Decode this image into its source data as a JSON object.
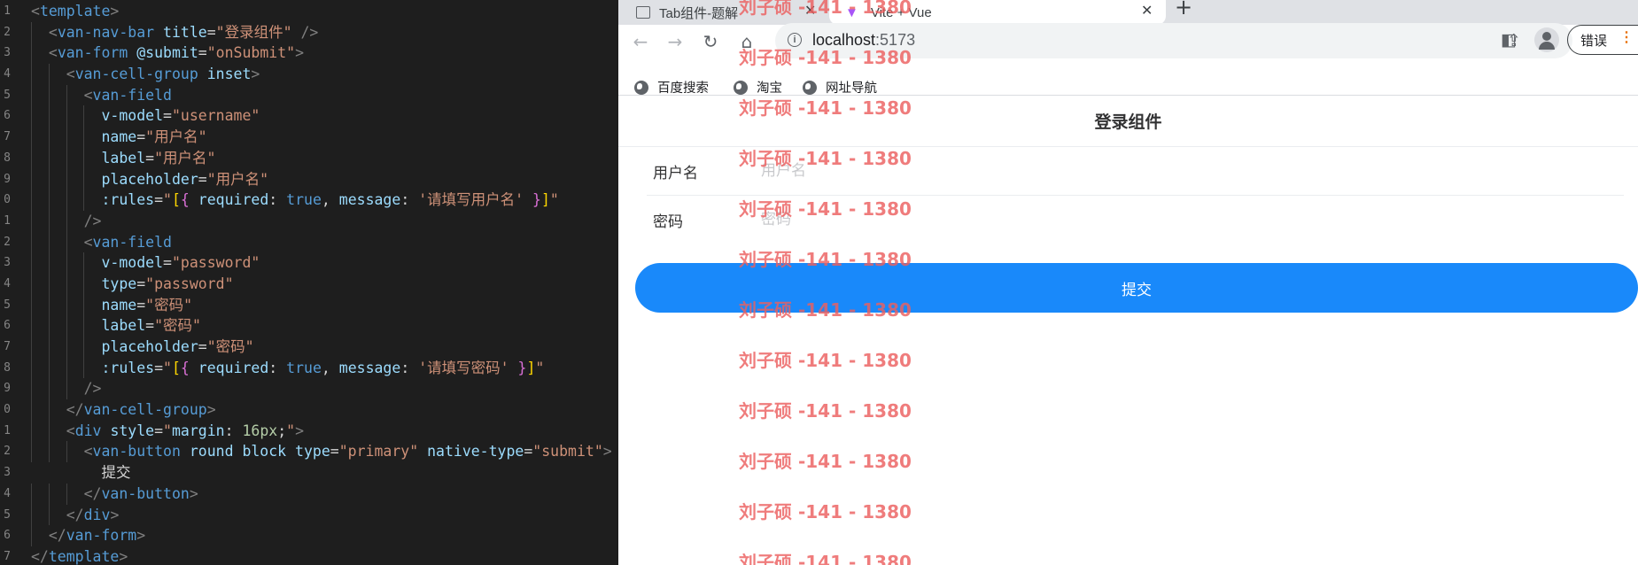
{
  "editor": {
    "lines": [
      [
        {
          "c": "c-br",
          "t": "<"
        },
        {
          "c": "c-tag",
          "t": "template"
        },
        {
          "c": "c-br",
          "t": ">"
        }
      ],
      [
        {
          "c": "",
          "t": "  "
        },
        {
          "c": "c-br",
          "t": "<"
        },
        {
          "c": "c-tag",
          "t": "van-nav-bar"
        },
        {
          "c": "",
          "t": " "
        },
        {
          "c": "c-attr",
          "t": "title"
        },
        {
          "c": "",
          "t": "="
        },
        {
          "c": "c-str",
          "t": "\"登录组件\""
        },
        {
          "c": "",
          "t": " "
        },
        {
          "c": "c-br",
          "t": "/>"
        }
      ],
      [
        {
          "c": "",
          "t": "  "
        },
        {
          "c": "c-br",
          "t": "<"
        },
        {
          "c": "c-tag",
          "t": "van-form"
        },
        {
          "c": "",
          "t": " "
        },
        {
          "c": "c-attr",
          "t": "@submit"
        },
        {
          "c": "",
          "t": "="
        },
        {
          "c": "c-str",
          "t": "\"onSubmit\""
        },
        {
          "c": "c-br",
          "t": ">"
        }
      ],
      [
        {
          "c": "",
          "t": "    "
        },
        {
          "c": "c-br",
          "t": "<"
        },
        {
          "c": "c-tag",
          "t": "van-cell-group"
        },
        {
          "c": "",
          "t": " "
        },
        {
          "c": "c-attr",
          "t": "inset"
        },
        {
          "c": "c-br",
          "t": ">"
        }
      ],
      [
        {
          "c": "",
          "t": "      "
        },
        {
          "c": "c-br",
          "t": "<"
        },
        {
          "c": "c-tag",
          "t": "van-field"
        }
      ],
      [
        {
          "c": "",
          "t": "        "
        },
        {
          "c": "c-attr",
          "t": "v-model"
        },
        {
          "c": "",
          "t": "="
        },
        {
          "c": "c-str",
          "t": "\"username\""
        }
      ],
      [
        {
          "c": "",
          "t": "        "
        },
        {
          "c": "c-attr",
          "t": "name"
        },
        {
          "c": "",
          "t": "="
        },
        {
          "c": "c-str",
          "t": "\"用户名\""
        }
      ],
      [
        {
          "c": "",
          "t": "        "
        },
        {
          "c": "c-attr",
          "t": "label"
        },
        {
          "c": "",
          "t": "="
        },
        {
          "c": "c-str",
          "t": "\"用户名\""
        }
      ],
      [
        {
          "c": "",
          "t": "        "
        },
        {
          "c": "c-attr",
          "t": "placeholder"
        },
        {
          "c": "",
          "t": "="
        },
        {
          "c": "c-str",
          "t": "\"用户名\""
        }
      ],
      [
        {
          "c": "",
          "t": "        "
        },
        {
          "c": "c-attr",
          "t": ":rules"
        },
        {
          "c": "",
          "t": "="
        },
        {
          "c": "c-str",
          "t": "\""
        },
        {
          "c": "c-p1",
          "t": "["
        },
        {
          "c": "c-p2",
          "t": "{"
        },
        {
          "c": "",
          "t": " "
        },
        {
          "c": "c-attr",
          "t": "required"
        },
        {
          "c": "",
          "t": ": "
        },
        {
          "c": "c-key",
          "t": "true"
        },
        {
          "c": "",
          "t": ", "
        },
        {
          "c": "c-attr",
          "t": "message"
        },
        {
          "c": "",
          "t": ": "
        },
        {
          "c": "c-str",
          "t": "'请填写用户名'"
        },
        {
          "c": "",
          "t": " "
        },
        {
          "c": "c-p2",
          "t": "}"
        },
        {
          "c": "c-p1",
          "t": "]"
        },
        {
          "c": "c-str",
          "t": "\""
        }
      ],
      [
        {
          "c": "",
          "t": "      "
        },
        {
          "c": "c-br",
          "t": "/>"
        }
      ],
      [
        {
          "c": "",
          "t": "      "
        },
        {
          "c": "c-br",
          "t": "<"
        },
        {
          "c": "c-tag",
          "t": "van-field"
        }
      ],
      [
        {
          "c": "",
          "t": "        "
        },
        {
          "c": "c-attr",
          "t": "v-model"
        },
        {
          "c": "",
          "t": "="
        },
        {
          "c": "c-str",
          "t": "\"password\""
        }
      ],
      [
        {
          "c": "",
          "t": "        "
        },
        {
          "c": "c-attr",
          "t": "type"
        },
        {
          "c": "",
          "t": "="
        },
        {
          "c": "c-str",
          "t": "\"password\""
        }
      ],
      [
        {
          "c": "",
          "t": "        "
        },
        {
          "c": "c-attr",
          "t": "name"
        },
        {
          "c": "",
          "t": "="
        },
        {
          "c": "c-str",
          "t": "\"密码\""
        }
      ],
      [
        {
          "c": "",
          "t": "        "
        },
        {
          "c": "c-attr",
          "t": "label"
        },
        {
          "c": "",
          "t": "="
        },
        {
          "c": "c-str",
          "t": "\"密码\""
        }
      ],
      [
        {
          "c": "",
          "t": "        "
        },
        {
          "c": "c-attr",
          "t": "placeholder"
        },
        {
          "c": "",
          "t": "="
        },
        {
          "c": "c-str",
          "t": "\"密码\""
        }
      ],
      [
        {
          "c": "",
          "t": "        "
        },
        {
          "c": "c-attr",
          "t": ":rules"
        },
        {
          "c": "",
          "t": "="
        },
        {
          "c": "c-str",
          "t": "\""
        },
        {
          "c": "c-p1",
          "t": "["
        },
        {
          "c": "c-p2",
          "t": "{"
        },
        {
          "c": "",
          "t": " "
        },
        {
          "c": "c-attr",
          "t": "required"
        },
        {
          "c": "",
          "t": ": "
        },
        {
          "c": "c-key",
          "t": "true"
        },
        {
          "c": "",
          "t": ", "
        },
        {
          "c": "c-attr",
          "t": "message"
        },
        {
          "c": "",
          "t": ": "
        },
        {
          "c": "c-str",
          "t": "'请填写密码'"
        },
        {
          "c": "",
          "t": " "
        },
        {
          "c": "c-p2",
          "t": "}"
        },
        {
          "c": "c-p1",
          "t": "]"
        },
        {
          "c": "c-str",
          "t": "\""
        }
      ],
      [
        {
          "c": "",
          "t": "      "
        },
        {
          "c": "c-br",
          "t": "/>"
        }
      ],
      [
        {
          "c": "",
          "t": "    "
        },
        {
          "c": "c-br",
          "t": "</"
        },
        {
          "c": "c-tag",
          "t": "van-cell-group"
        },
        {
          "c": "c-br",
          "t": ">"
        }
      ],
      [
        {
          "c": "",
          "t": "    "
        },
        {
          "c": "c-br",
          "t": "<"
        },
        {
          "c": "c-tag",
          "t": "div"
        },
        {
          "c": "",
          "t": " "
        },
        {
          "c": "c-attr",
          "t": "style"
        },
        {
          "c": "",
          "t": "="
        },
        {
          "c": "c-str",
          "t": "\""
        },
        {
          "c": "c-attr",
          "t": "margin"
        },
        {
          "c": "",
          "t": ": "
        },
        {
          "c": "c-num",
          "t": "16px"
        },
        {
          "c": "",
          "t": ";"
        },
        {
          "c": "c-str",
          "t": "\""
        },
        {
          "c": "c-br",
          "t": ">"
        }
      ],
      [
        {
          "c": "",
          "t": "      "
        },
        {
          "c": "c-br",
          "t": "<"
        },
        {
          "c": "c-tag",
          "t": "van-button"
        },
        {
          "c": "",
          "t": " "
        },
        {
          "c": "c-attr",
          "t": "round"
        },
        {
          "c": "",
          "t": " "
        },
        {
          "c": "c-attr",
          "t": "block"
        },
        {
          "c": "",
          "t": " "
        },
        {
          "c": "c-attr",
          "t": "type"
        },
        {
          "c": "",
          "t": "="
        },
        {
          "c": "c-str",
          "t": "\"primary\""
        },
        {
          "c": "",
          "t": " "
        },
        {
          "c": "c-attr",
          "t": "native-type"
        },
        {
          "c": "",
          "t": "="
        },
        {
          "c": "c-str",
          "t": "\"submit\""
        },
        {
          "c": "c-br",
          "t": ">"
        }
      ],
      [
        {
          "c": "",
          "t": "        提交"
        }
      ],
      [
        {
          "c": "",
          "t": "      "
        },
        {
          "c": "c-br",
          "t": "</"
        },
        {
          "c": "c-tag",
          "t": "van-button"
        },
        {
          "c": "c-br",
          "t": ">"
        }
      ],
      [
        {
          "c": "",
          "t": "    "
        },
        {
          "c": "c-br",
          "t": "</"
        },
        {
          "c": "c-tag",
          "t": "div"
        },
        {
          "c": "c-br",
          "t": ">"
        }
      ],
      [
        {
          "c": "",
          "t": "  "
        },
        {
          "c": "c-br",
          "t": "</"
        },
        {
          "c": "c-tag",
          "t": "van-form"
        },
        {
          "c": "c-br",
          "t": ">"
        }
      ],
      [
        {
          "c": "c-br",
          "t": "</"
        },
        {
          "c": "c-tag",
          "t": "template"
        },
        {
          "c": "c-br",
          "t": ">"
        }
      ]
    ],
    "line_numbers": [
      "1",
      "2",
      "3",
      "4",
      "5",
      "6",
      "7",
      "8",
      "9",
      "0",
      "1",
      "2",
      "3",
      "4",
      "5",
      "6",
      "7",
      "8",
      "9",
      "0",
      "1",
      "2",
      "3",
      "4",
      "5",
      "6",
      "7"
    ]
  },
  "browser": {
    "tabs": [
      {
        "title": "Tab组件-题解",
        "active": false
      },
      {
        "title": "Vite + Vue",
        "active": true
      }
    ],
    "new_tab_label": "+",
    "url_host": "localhost",
    "url_port": ":5173",
    "bookmarks": [
      "百度搜索",
      "淘宝",
      "网址导航"
    ],
    "error_button_label": "错误",
    "error_button_dots": "⋮"
  },
  "page": {
    "nav_title": "登录组件",
    "fields": [
      {
        "label": "用户名",
        "placeholder": "用户名",
        "value": "",
        "type": "text"
      },
      {
        "label": "密码",
        "placeholder": "密码",
        "value": "",
        "type": "password"
      }
    ],
    "submit_label": "提交"
  },
  "watermark": {
    "text": "刘子硕 -141 - 1380",
    "repeat": 12
  },
  "colors": {
    "editor_bg": "#1e1e1e",
    "vant_primary": "#1989fa",
    "watermark": "#ec5f5f"
  }
}
